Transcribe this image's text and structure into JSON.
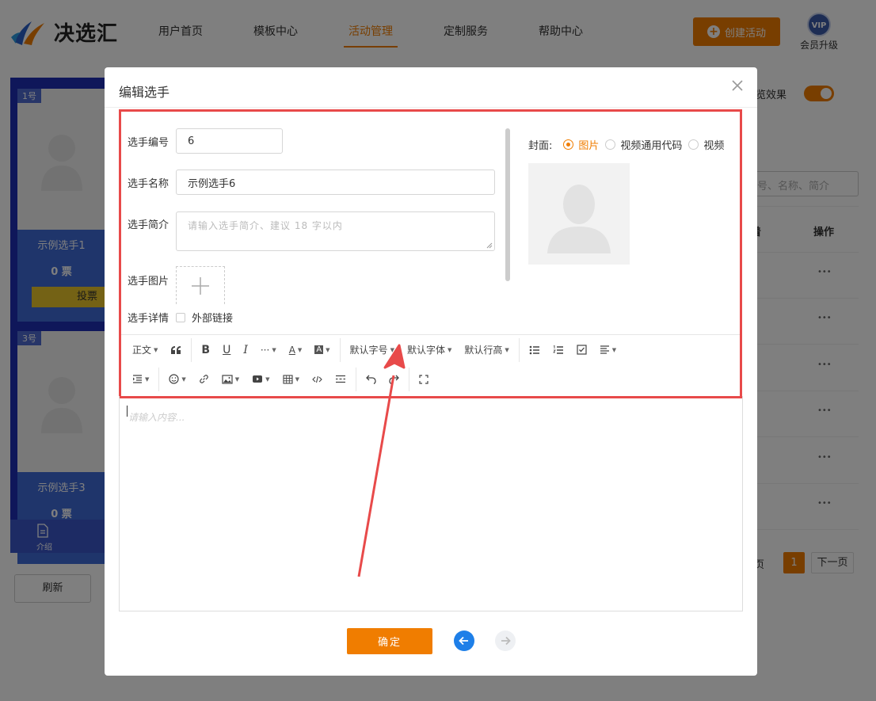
{
  "header": {
    "logo_text": "决选汇",
    "nav": [
      "用户首页",
      "模板中心",
      "活动管理",
      "定制服务",
      "帮助中心"
    ],
    "active_nav": "活动管理",
    "create_button": "创建活动",
    "vip_badge": "VIP",
    "vip_label": "会员升级"
  },
  "background": {
    "cards": [
      {
        "number": "1号",
        "name": "示例选手1",
        "votes": "0 票",
        "vote_button": "投票"
      },
      {
        "number": "3号",
        "name": "示例选手3",
        "votes": "0 票"
      }
    ],
    "phone_tab": "介绍",
    "refresh_button": "刷新",
    "preview_label": "览效果",
    "search_placeholder": "号、名称、简介",
    "column_header": "操作",
    "row_action": "•••",
    "column_partial": "着",
    "pagination": {
      "prev": "页",
      "current": "1",
      "next": "下一页"
    }
  },
  "modal": {
    "title": "编辑选手",
    "fields": {
      "number_label": "选手编号",
      "number_value": "6",
      "name_label": "选手名称",
      "name_value": "示例选手6",
      "intro_label": "选手简介",
      "intro_placeholder": "请输入选手简介、建议 18 字以内",
      "image_label": "选手图片",
      "detail_label": "选手详情",
      "external_link_label": "外部链接"
    },
    "cover": {
      "label": "封面:",
      "options": [
        "图片",
        "视频通用代码",
        "视频"
      ],
      "selected": "图片"
    },
    "toolbar": {
      "paragraph": "正文",
      "font_size": "默认字号",
      "font_family": "默认字体",
      "line_height": "默认行高",
      "more": "···",
      "bold": "B",
      "underline": "U",
      "italic": "I",
      "font_color": "A",
      "bg_color": "A"
    },
    "editor_placeholder": "请输入内容...",
    "confirm_button": "确定"
  },
  "colors": {
    "accent": "#f07d00",
    "highlight_box": "#e84a4a",
    "nav_blue": "#1e7fe8"
  }
}
